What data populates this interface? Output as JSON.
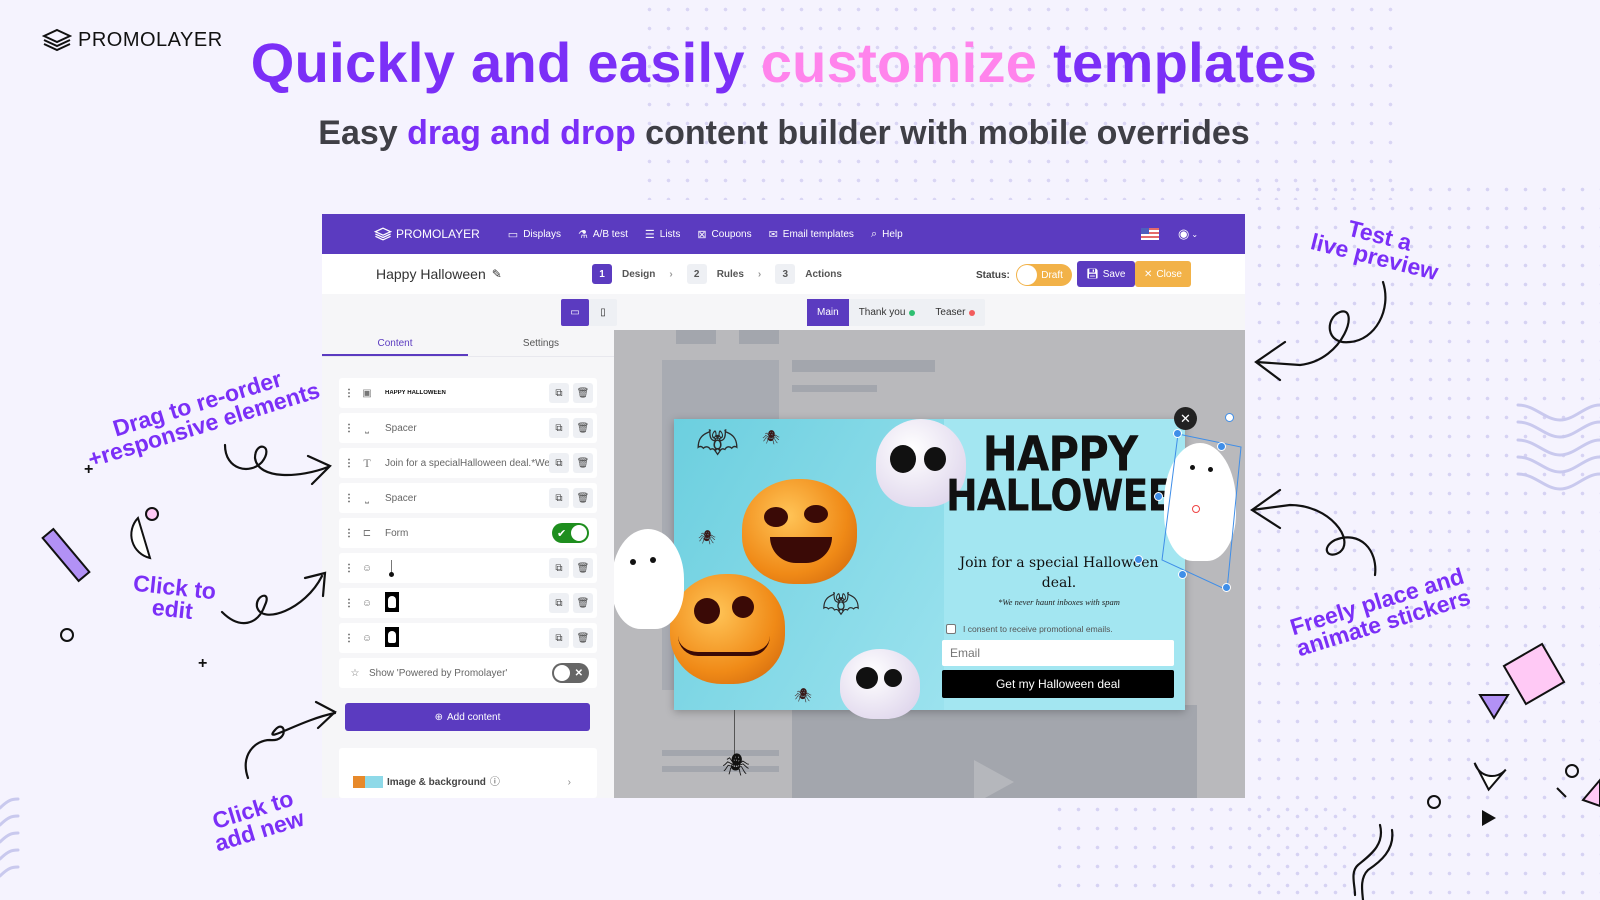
{
  "brand": {
    "name": "PROMOLAYER"
  },
  "hero": {
    "title_part1": "Quickly and easily",
    "title_highlight": "customize",
    "title_part2": "templates",
    "subtitle_part1": "Easy",
    "subtitle_highlight": "drag and drop",
    "subtitle_part2": "content builder with mobile overrides"
  },
  "colors": {
    "accent": "#7b2ff7",
    "highlight": "#ff84ec",
    "app_primary": "#5b3bc0",
    "draft": "#f2b248"
  },
  "app": {
    "nav": {
      "brand": "PROMOLAYER",
      "items": [
        {
          "label": "Displays",
          "icon": "monitor-icon"
        },
        {
          "label": "A/B test",
          "icon": "flask-icon"
        },
        {
          "label": "Lists",
          "icon": "list-icon"
        },
        {
          "label": "Coupons",
          "icon": "coupon-icon"
        },
        {
          "label": "Email templates",
          "icon": "email-icon"
        },
        {
          "label": "Help",
          "icon": "search-icon"
        }
      ]
    },
    "campaign_title": "Happy Halloween",
    "steps": [
      {
        "num": "1",
        "label": "Design"
      },
      {
        "num": "2",
        "label": "Rules"
      },
      {
        "num": "3",
        "label": "Actions"
      }
    ],
    "status_label": "Status:",
    "status_value": "Draft",
    "save_label": "Save",
    "close_label": "Close",
    "view_tabs": [
      {
        "label": "Main"
      },
      {
        "label": "Thank you",
        "dot": "#2fbf71"
      },
      {
        "label": "Teaser",
        "dot": "#f25c5c"
      }
    ],
    "sidebar": {
      "tabs": [
        "Content",
        "Settings"
      ],
      "rows": [
        {
          "type": "image",
          "label": ""
        },
        {
          "type": "spacer",
          "label": "Spacer"
        },
        {
          "type": "text",
          "label": "Join for a specialHalloween deal.*We..."
        },
        {
          "type": "spacer",
          "label": "Spacer"
        },
        {
          "type": "form",
          "label": "Form",
          "enabled": true
        },
        {
          "type": "sticker",
          "label": "spider"
        },
        {
          "type": "sticker",
          "label": "ghost"
        },
        {
          "type": "sticker",
          "label": "ghost"
        }
      ],
      "powered_by": "Show 'Powered by Promolayer'",
      "powered_by_enabled": false,
      "add_content": "Add content",
      "image_bg": "Image & background"
    },
    "popup": {
      "headline_line1": "HAPPY",
      "headline_line2": "HALLOWEEN",
      "body": "Join for a special Halloween deal.",
      "note": "*We never haunt inboxes with spam",
      "consent": "I consent to receive promotional emails.",
      "email_placeholder": "Email",
      "cta": "Get my Halloween deal"
    }
  },
  "annotations": {
    "drag": "Drag to re-order\n+responsive elements",
    "edit": "Click to\nedit",
    "add": "Click to\nadd new",
    "preview": "Test a\nlive preview",
    "stickers": "Freely place and\nanimate stickers"
  }
}
